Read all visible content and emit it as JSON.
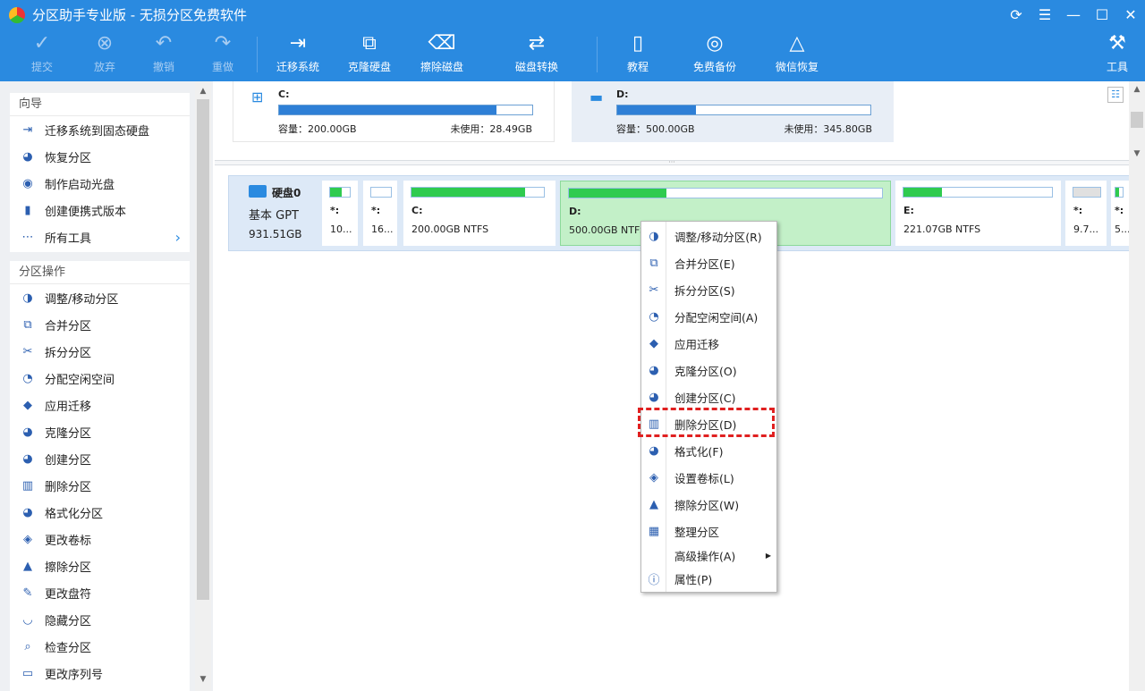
{
  "window": {
    "title": "分区助手专业版 - 无损分区免费软件",
    "controls": [
      "refresh-icon",
      "menu-icon",
      "minimize-icon",
      "maximize-icon",
      "close-icon"
    ]
  },
  "toolbar": {
    "commit": "提交",
    "discard": "放弃",
    "undo": "撤销",
    "redo": "重做",
    "migrate_os": "迁移系统",
    "clone_disk": "克隆硬盘",
    "wipe_disk": "擦除磁盘",
    "disk_convert": "磁盘转换",
    "tutorial": "教程",
    "free_backup": "免费备份",
    "wechat_recovery": "微信恢复",
    "tools": "工具"
  },
  "wizard": {
    "title": "向导",
    "items": [
      {
        "label": "迁移系统到固态硬盘",
        "icon": "migrate-icon"
      },
      {
        "label": "恢复分区",
        "icon": "recover-icon"
      },
      {
        "label": "制作启动光盘",
        "icon": "boot-disc-icon"
      },
      {
        "label": "创建便携式版本",
        "icon": "portable-icon"
      },
      {
        "label": "所有工具",
        "icon": "all-tools-icon"
      }
    ]
  },
  "partition_ops": {
    "title": "分区操作",
    "items": [
      {
        "label": "调整/移动分区"
      },
      {
        "label": "合并分区"
      },
      {
        "label": "拆分分区"
      },
      {
        "label": "分配空闲空间"
      },
      {
        "label": "应用迁移"
      },
      {
        "label": "克隆分区"
      },
      {
        "label": "创建分区"
      },
      {
        "label": "删除分区"
      },
      {
        "label": "格式化分区"
      },
      {
        "label": "更改卷标"
      },
      {
        "label": "擦除分区"
      },
      {
        "label": "更改盘符"
      },
      {
        "label": "隐藏分区"
      },
      {
        "label": "检查分区"
      },
      {
        "label": "更改序列号"
      }
    ]
  },
  "volumes": [
    {
      "letter": "C:",
      "capacity": "容量：200.00GB",
      "free": "未使用：28.49GB",
      "used_fraction": 0.86
    },
    {
      "letter": "D:",
      "capacity": "容量：500.00GB",
      "free": "未使用：345.80GB",
      "used_fraction": 0.31
    }
  ],
  "disk": {
    "name": "硬盘0",
    "type": "基本 GPT",
    "size": "931.51GB",
    "partitions": [
      {
        "label": "*:",
        "info": "10...",
        "used_fraction": 0.6
      },
      {
        "label": "*:",
        "info": "16...",
        "used_fraction": 0.0
      },
      {
        "label": "C:",
        "info": "200.00GB NTFS",
        "used_fraction": 0.86
      },
      {
        "label": "D:",
        "info": "500.00GB NTFS",
        "used_fraction": 0.31
      },
      {
        "label": "E:",
        "info": "221.07GB NTFS",
        "used_fraction": 0.26
      },
      {
        "label": "*:",
        "info": "9.7...",
        "used_fraction": 0.0
      },
      {
        "label": "*:",
        "info": "5...",
        "used_fraction": 0.5
      }
    ]
  },
  "context_menu": {
    "items": [
      {
        "label": "调整/移动分区(R)"
      },
      {
        "label": "合并分区(E)"
      },
      {
        "label": "拆分分区(S)"
      },
      {
        "label": "分配空闲空间(A)"
      },
      {
        "label": "应用迁移"
      },
      {
        "label": "克隆分区(O)"
      },
      {
        "label": "创建分区(C)"
      },
      {
        "label": "删除分区(D)"
      },
      {
        "label": "格式化(F)"
      },
      {
        "label": "设置卷标(L)"
      },
      {
        "label": "擦除分区(W)"
      },
      {
        "label": "整理分区"
      },
      {
        "label": "高级操作(A)"
      },
      {
        "label": "属性(P)"
      }
    ],
    "highlighted": "删除分区(D)"
  },
  "colors": {
    "titlebar": "#2a8ae0",
    "used_bar": "#2e7fd6",
    "partition_bar": "#2fcb4f",
    "selected_partition": "#c3f0c8",
    "highlight_box": "#e02020"
  }
}
